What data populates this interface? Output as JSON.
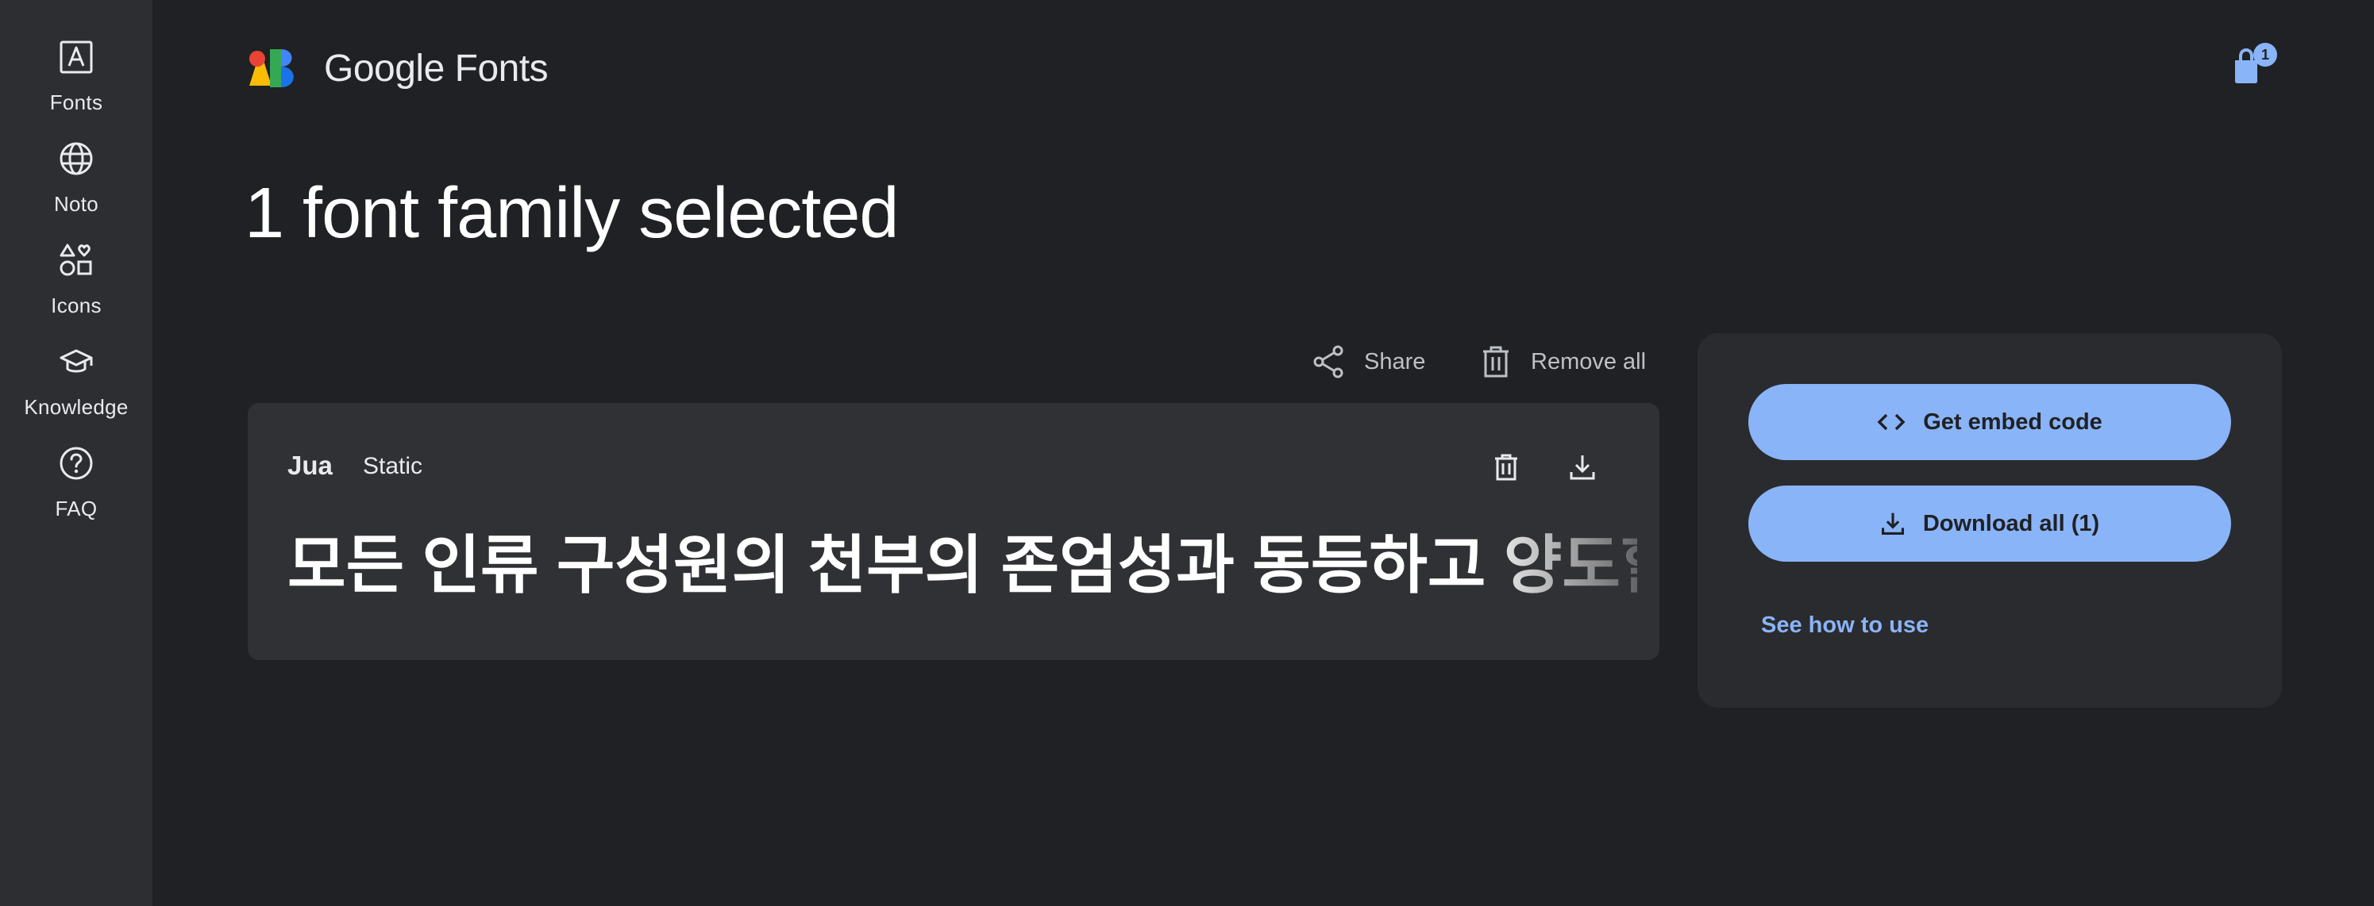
{
  "sidebar": {
    "items": [
      {
        "label": "Fonts",
        "icon": "font-a-icon"
      },
      {
        "label": "Noto",
        "icon": "globe-icon"
      },
      {
        "label": "Icons",
        "icon": "shapes-icon"
      },
      {
        "label": "Knowledge",
        "icon": "graduation-cap-icon"
      },
      {
        "label": "FAQ",
        "icon": "help-circle-icon"
      }
    ]
  },
  "header": {
    "logo_google": "Google",
    "logo_fonts": "Fonts",
    "cart_count": "1"
  },
  "page_title": "1 font family selected",
  "actions": {
    "share_label": "Share",
    "remove_all_label": "Remove all"
  },
  "font_card": {
    "family": "Jua",
    "style": "Static",
    "sample_text": "모든 인류 구성원의 천부의 존엄성과 동등하고 양도할 수 없는 권리를 인정하는 것이"
  },
  "panel": {
    "embed_label": "Get embed code",
    "download_label": "Download all (1)",
    "see_how_label": "See how to use"
  },
  "colors": {
    "background": "#202124",
    "sidebar": "#2d2e31",
    "card": "#303134",
    "accent": "#8ab4f8"
  }
}
